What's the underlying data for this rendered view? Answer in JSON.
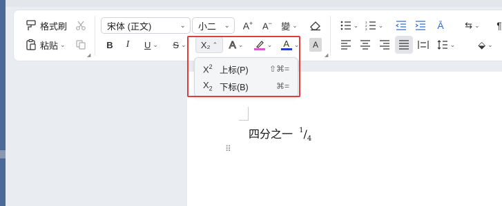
{
  "clipboard": {
    "format_painter_label": "格式刷",
    "paste_label": "粘贴"
  },
  "font": {
    "family_value": "宋体 (正文)",
    "size_value": "小二"
  },
  "subscript_menu": {
    "current_icon": "X₂",
    "items": [
      {
        "icon_base": "X",
        "icon_mark": "2",
        "label": "上标(P)",
        "shortcut": "⇧⌘="
      },
      {
        "icon_base": "X",
        "icon_mark": "2",
        "label": "下标(B)",
        "shortcut": "⌘="
      }
    ]
  },
  "document": {
    "text": "四分之一",
    "fraction_numerator": "1",
    "fraction_slash": "/",
    "fraction_denominator": "4"
  },
  "colors": {
    "highlight_color": "#d05cd0",
    "font_color": "#1c3fc9",
    "annotation_border": "#e23b3b"
  },
  "icons": {
    "text_shading": "A",
    "text_effect": "A",
    "bold": "B",
    "italic": "I",
    "underline": "U",
    "strikethrough": "S",
    "grow_font": "A⁺",
    "shrink_font": "A⁻",
    "phonetic": "變",
    "clear_format": "eraser-icon"
  }
}
